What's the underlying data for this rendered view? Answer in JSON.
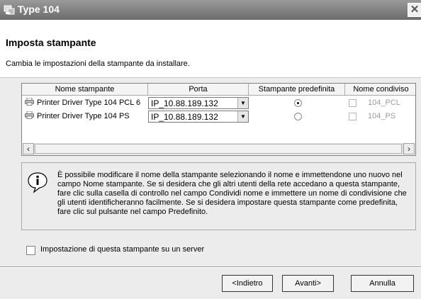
{
  "window": {
    "title": "Type 104",
    "icon": "setup-icon",
    "close_label": "✕"
  },
  "header": {
    "title": "Imposta stampante",
    "subtitle": "Cambia le impostazioni della stampante da installare."
  },
  "table": {
    "columns": [
      "Nome stampante",
      "Porta",
      "Stampante predefinita",
      "Nome condiviso"
    ],
    "rows": [
      {
        "name": "Printer Driver Type 104 PCL 6",
        "port": "IP_10.88.189.132",
        "default": true,
        "shared": false,
        "share_name": "104_PCL"
      },
      {
        "name": "Printer Driver Type 104 PS",
        "port": "IP_10.88.189.132",
        "default": false,
        "shared": false,
        "share_name": "104_PS"
      }
    ]
  },
  "info": {
    "icon": "info-icon",
    "text": "È possibile modificare il nome della stampante selezionando il nome e immettendone uno nuovo nel campo Nome stampante. Se si desidera che gli altri utenti della rete accedano a questa stampante, fare clic sulla casella di controllo nel campo Condividi nome e immettere un nome di condivisione che gli utenti identificheranno facilmente. Se si desidera impostare questa stampante come predefinita, fare clic sul pulsante nel campo Predefinito."
  },
  "server_option": {
    "label": "Impostazione di questa stampante su un server",
    "checked": false
  },
  "buttons": {
    "back": "<Indietro",
    "next": "Avanti>",
    "cancel": "Annulla"
  }
}
